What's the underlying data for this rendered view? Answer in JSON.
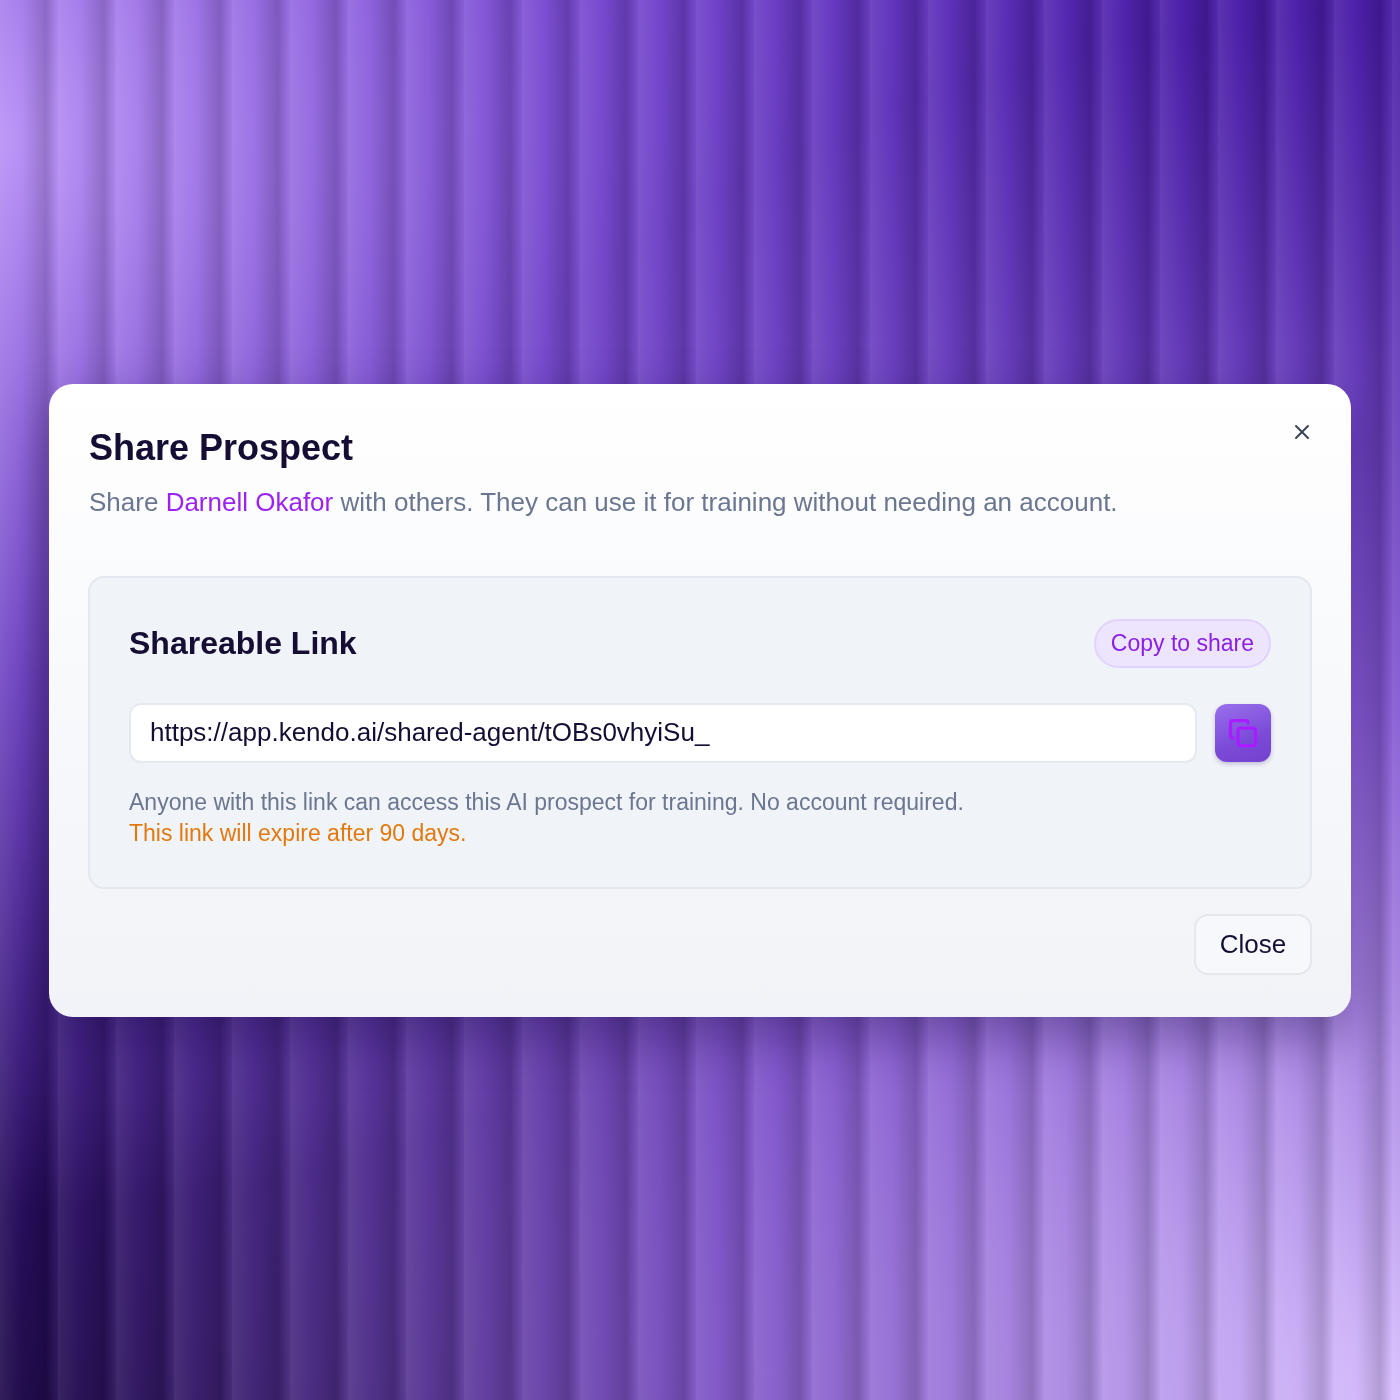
{
  "dialog": {
    "title": "Share Prospect",
    "description": {
      "lead": "Share",
      "name": "Darnell Okafor",
      "rest": "with others. They can use it for training without needing an account."
    }
  },
  "link_section": {
    "title": "Shareable Link",
    "copy_button": "Copy to share",
    "url": "https://app.kendo.ai/shared-agent/tOBs0vhyiSu_",
    "note": "Anyone with this link can access this AI prospect for training. No account required.",
    "warning": "This link will expire after 90 days."
  },
  "footer": {
    "close_button": "Close"
  }
}
